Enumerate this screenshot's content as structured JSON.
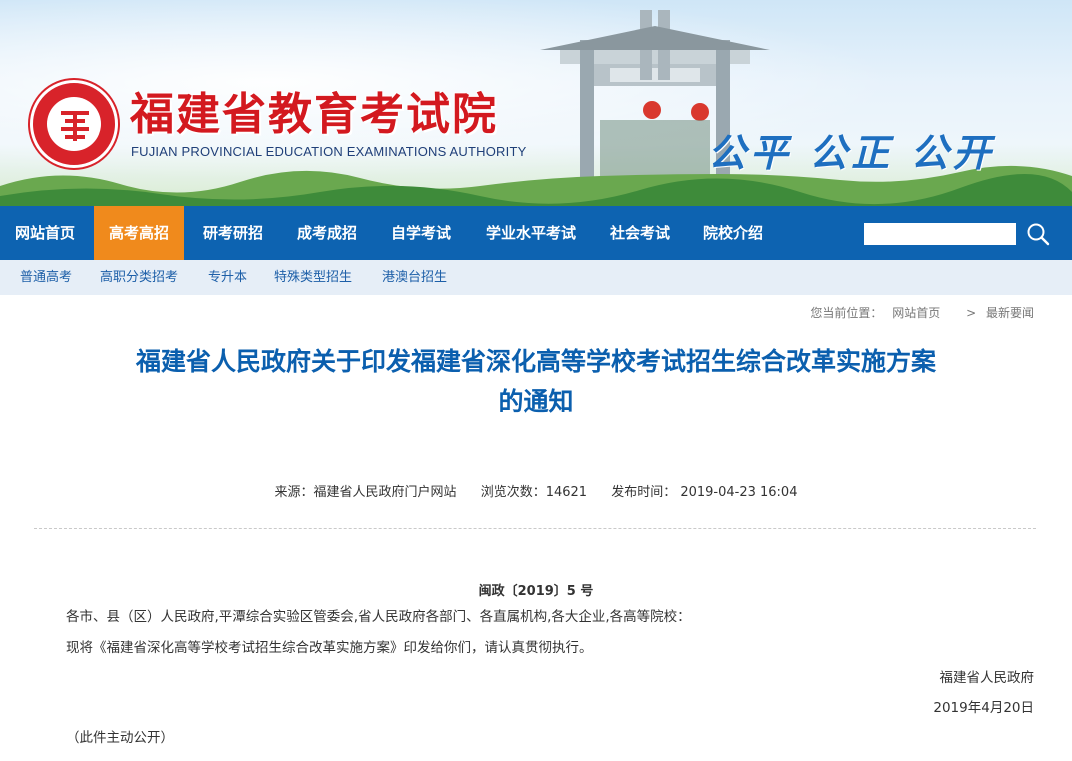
{
  "header": {
    "site_title": "福建省教育考试院",
    "site_subtitle": "FUJIAN PROVINCIAL EDUCATION EXAMINATIONS AUTHORITY",
    "motto": "公平 公正 公开"
  },
  "main_nav": {
    "items": [
      {
        "label": "网站首页",
        "active": false
      },
      {
        "label": "高考高招",
        "active": true
      },
      {
        "label": "研考研招",
        "active": false
      },
      {
        "label": "成考成招",
        "active": false
      },
      {
        "label": "自学考试",
        "active": false
      },
      {
        "label": "学业水平考试",
        "active": false
      },
      {
        "label": "社会考试",
        "active": false
      },
      {
        "label": "院校介绍",
        "active": false
      }
    ],
    "search_value": "",
    "colors": {
      "bar": "#0d63b1",
      "active": "#f08a1c"
    }
  },
  "sub_nav": {
    "items": [
      "普通高考",
      "高职分类招考",
      "专升本",
      "特殊类型招生",
      "港澳台招生"
    ]
  },
  "breadcrumb": {
    "prefix": "您当前位置：",
    "home": "网站首页",
    "separator": ">",
    "current": "最新要闻"
  },
  "article": {
    "title_line1": "福建省人民政府关于印发福建省深化高等学校考试招生综合改革实施方案",
    "title_line2": "的通知",
    "source": "来源：福建省人民政府门户网站",
    "views": "浏览次数：14621",
    "published": "发布时间： 2019-04-23 16:04",
    "doc_number": "闽政〔2019〕5 号",
    "recipients": "各市、县（区）人民政府,平潭综合实验区管委会,省人民政府各部门、各直属机构,各大企业,各高等院校：",
    "body": "现将《福建省深化高等学校考试招生综合改革实施方案》印发给你们，请认真贯彻执行。",
    "issuer": "福建省人民政府",
    "date": "2019年4月20日",
    "note": "（此件主动公开）",
    "title_color": "#0b5fae"
  }
}
